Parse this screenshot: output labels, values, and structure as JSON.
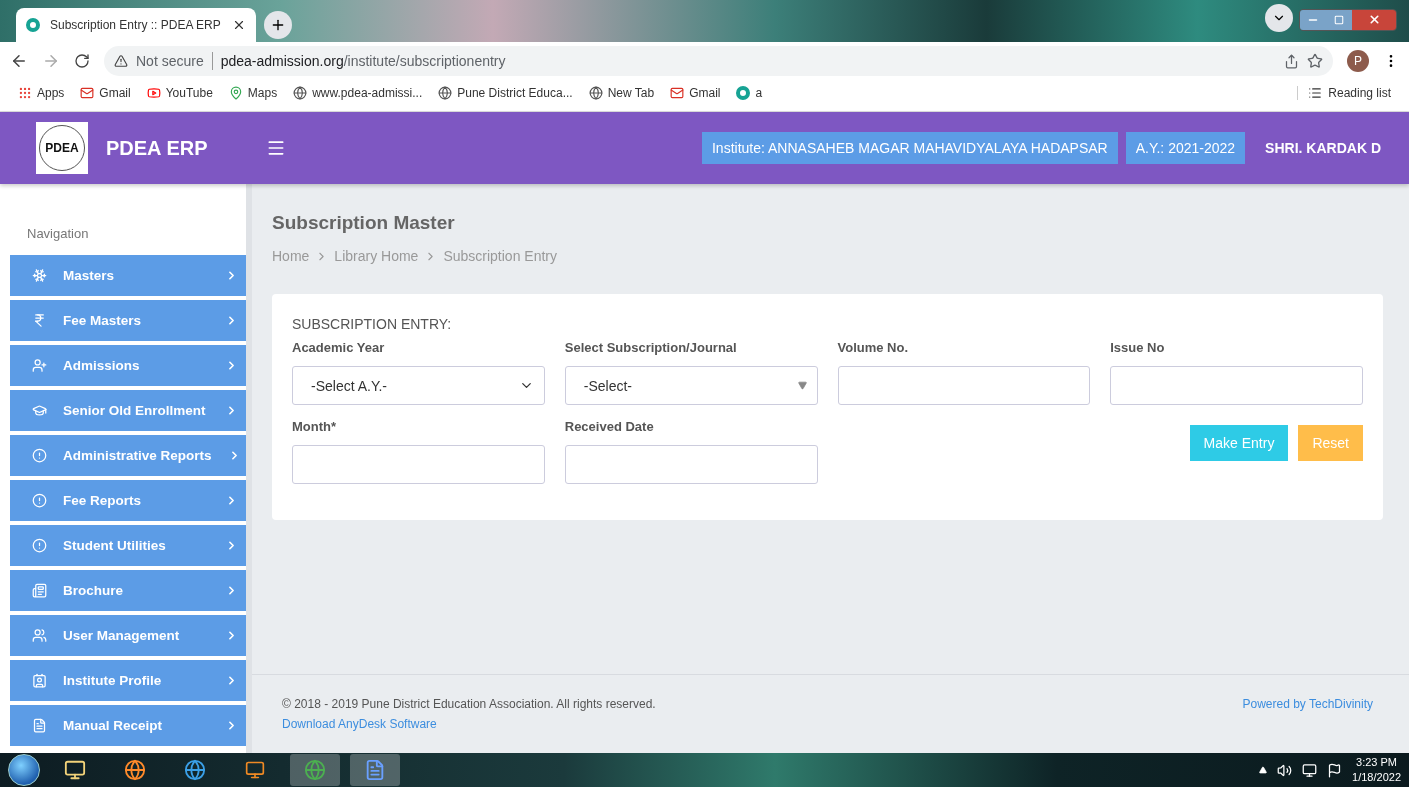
{
  "browser": {
    "tab_title": "Subscription Entry :: PDEA ERP",
    "security": "Not secure",
    "url_host": "pdea-admission.org",
    "url_path": "/institute/subscriptionentry",
    "profile": "P",
    "bookmarks": [
      "Apps",
      "Gmail",
      "YouTube",
      "Maps",
      "www.pdea-admissi...",
      "Pune District Educa...",
      "New Tab",
      "Gmail",
      "a"
    ],
    "reading_list": "Reading list"
  },
  "header": {
    "brand": "PDEA ERP",
    "logo_text": "PDEA",
    "institute": "Institute: ANNASAHEB MAGAR MAHAVIDYALAYA HADAPSAR",
    "academic_year": "A.Y.: 2021-2022",
    "user": "SHRI. KARDAK D"
  },
  "sidebar": {
    "heading": "Navigation",
    "items": [
      {
        "label": "Masters"
      },
      {
        "label": "Fee Masters"
      },
      {
        "label": "Admissions"
      },
      {
        "label": "Senior Old Enrollment"
      },
      {
        "label": "Administrative Reports"
      },
      {
        "label": "Fee Reports"
      },
      {
        "label": "Student Utilities"
      },
      {
        "label": "Brochure"
      },
      {
        "label": "User Management"
      },
      {
        "label": "Institute Profile"
      },
      {
        "label": "Manual Receipt"
      }
    ]
  },
  "page": {
    "title": "Subscription Master",
    "breadcrumbs": [
      "Home",
      "Library Home",
      "Subscription Entry"
    ],
    "form": {
      "heading": "SUBSCRIPTION ENTRY:",
      "fields": [
        {
          "label": "Academic Year",
          "kind": "select",
          "value": "-Select A.Y.-"
        },
        {
          "label": "Select Subscription/Journal",
          "kind": "combo",
          "value": "-Select-"
        },
        {
          "label": "Volume No.",
          "kind": "text"
        },
        {
          "label": "Issue No",
          "kind": "text"
        },
        {
          "label": "Month*",
          "kind": "text"
        },
        {
          "label": "Received Date",
          "kind": "text"
        }
      ],
      "buttons": [
        {
          "label": "Make Entry",
          "kind": "info"
        },
        {
          "label": "Reset",
          "kind": "warning"
        }
      ]
    }
  },
  "footer": {
    "copyright": "© 2018 - 2019 Pune District Education Association. All rights reserved.",
    "link": "Download AnyDesk Software",
    "powered": "Powered by TechDivinity"
  },
  "taskbar": {
    "time": "3:23 PM",
    "date": "1/18/2022"
  }
}
